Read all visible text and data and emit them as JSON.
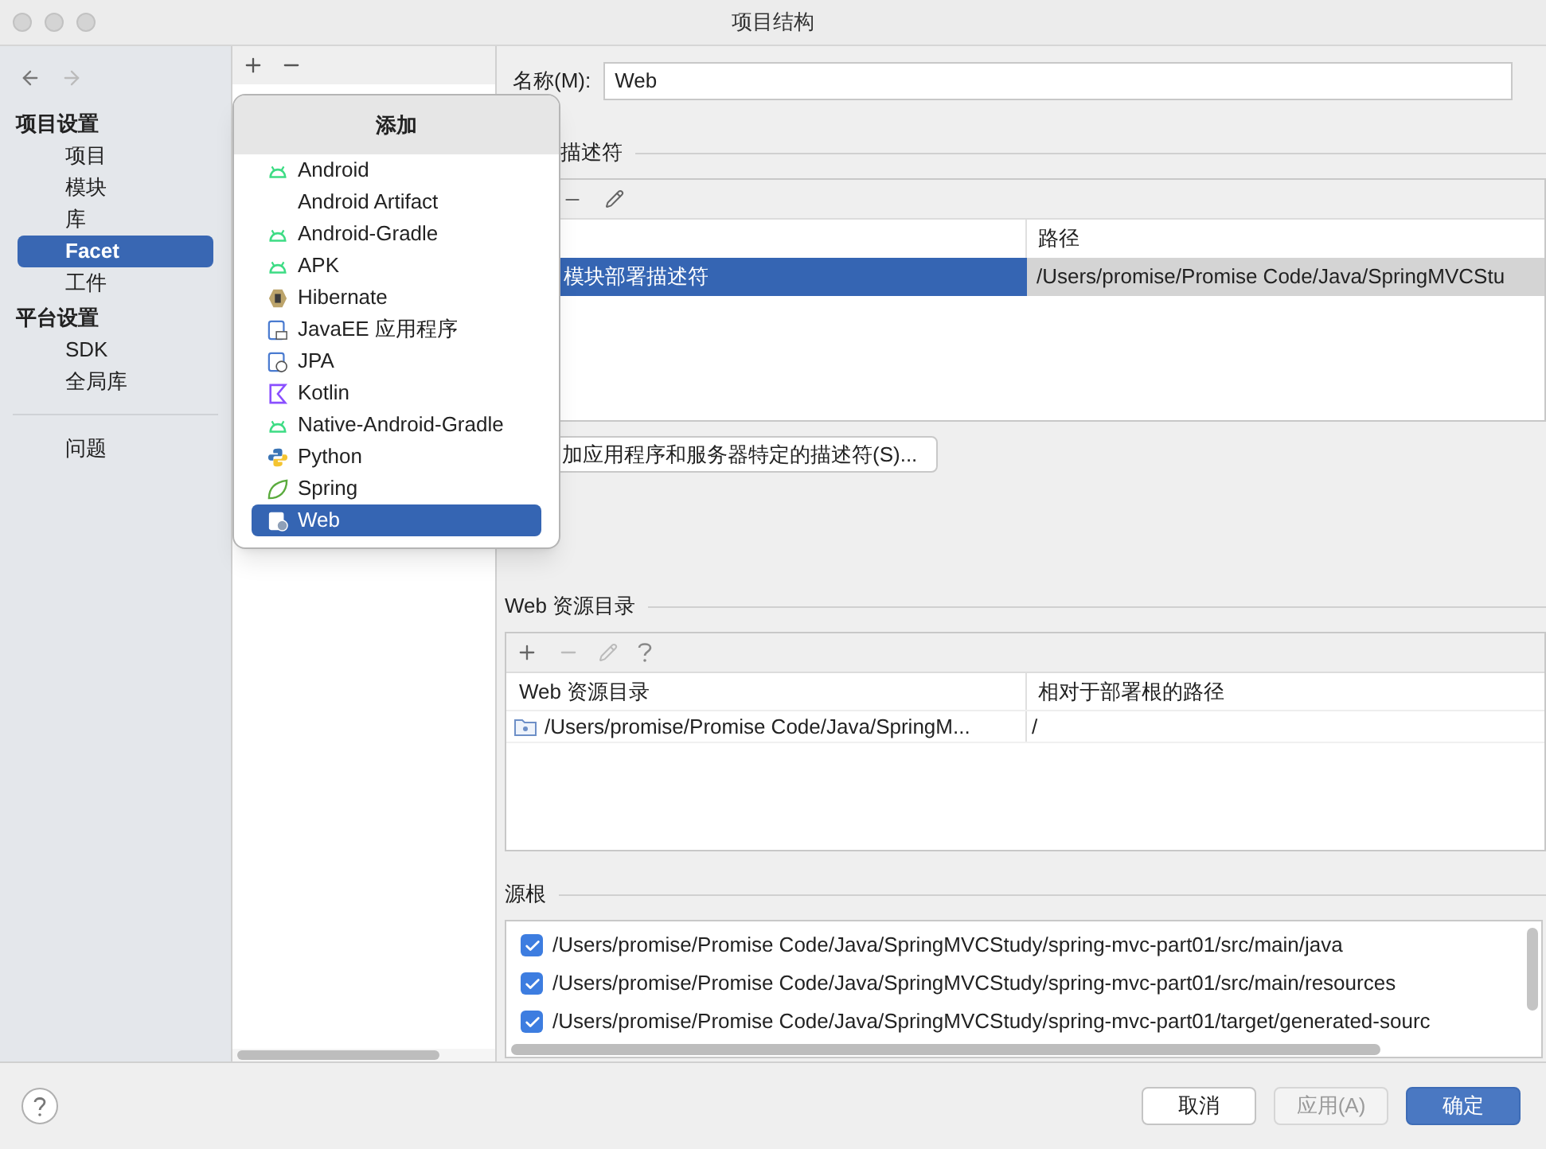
{
  "window": {
    "title": "项目结构"
  },
  "sidebar": {
    "sections": [
      {
        "title": "项目设置",
        "items": [
          {
            "label": "项目",
            "selected": false
          },
          {
            "label": "模块",
            "selected": false
          },
          {
            "label": "库",
            "selected": false
          },
          {
            "label": "Facet",
            "selected": true
          },
          {
            "label": "工件",
            "selected": false
          }
        ]
      },
      {
        "title": "平台设置",
        "items": [
          {
            "label": "SDK",
            "selected": false
          },
          {
            "label": "全局库",
            "selected": false
          }
        ]
      }
    ],
    "bottom_items": [
      {
        "label": "问题",
        "selected": false
      }
    ]
  },
  "add_popup": {
    "title": "添加",
    "items": [
      {
        "label": "Android",
        "kind": "android",
        "selected": false
      },
      {
        "label": "Android Artifact",
        "kind": "plain",
        "selected": false
      },
      {
        "label": "Android-Gradle",
        "kind": "android",
        "selected": false
      },
      {
        "label": "APK",
        "kind": "android",
        "selected": false
      },
      {
        "label": "Hibernate",
        "kind": "hibernate",
        "selected": false
      },
      {
        "label": "JavaEE 应用程序",
        "kind": "javaee",
        "selected": false
      },
      {
        "label": "JPA",
        "kind": "jpa",
        "selected": false
      },
      {
        "label": "Kotlin",
        "kind": "kotlin",
        "selected": false
      },
      {
        "label": "Native-Android-Gradle",
        "kind": "android",
        "selected": false
      },
      {
        "label": "Python",
        "kind": "python",
        "selected": false
      },
      {
        "label": "Spring",
        "kind": "spring",
        "selected": false
      },
      {
        "label": "Web",
        "kind": "web",
        "selected": true
      }
    ]
  },
  "name_field": {
    "label": "名称(M):",
    "value": "Web"
  },
  "descriptors": {
    "title": "描述符",
    "path_column": "路径",
    "rows": [
      {
        "name": "模块部署描述符",
        "path": "/Users/promise/Promise Code/Java/SpringMVCStu",
        "selected": true
      }
    ],
    "add_button": "加应用程序和服务器特定的描述符(S)..."
  },
  "web_resources": {
    "title": "Web 资源目录",
    "columns": [
      "Web 资源目录",
      "相对于部署根的路径"
    ],
    "rows": [
      {
        "directory": "/Users/promise/Promise Code/Java/SpringM...",
        "path": "/"
      }
    ]
  },
  "source_roots": {
    "title": "源根",
    "items": [
      {
        "path": "/Users/promise/Promise Code/Java/SpringMVCStudy/spring-mvc-part01/src/main/java",
        "checked": true
      },
      {
        "path": "/Users/promise/Promise Code/Java/SpringMVCStudy/spring-mvc-part01/src/main/resources",
        "checked": true
      },
      {
        "path": "/Users/promise/Promise Code/Java/SpringMVCStudy/spring-mvc-part01/target/generated-sourc",
        "checked": true
      }
    ]
  },
  "buttons": [
    {
      "label": "取消",
      "kind": "default",
      "disabled": false
    },
    {
      "label": "应用(A)",
      "kind": "default",
      "disabled": true
    },
    {
      "label": "确定",
      "kind": "primary",
      "disabled": false
    }
  ]
}
